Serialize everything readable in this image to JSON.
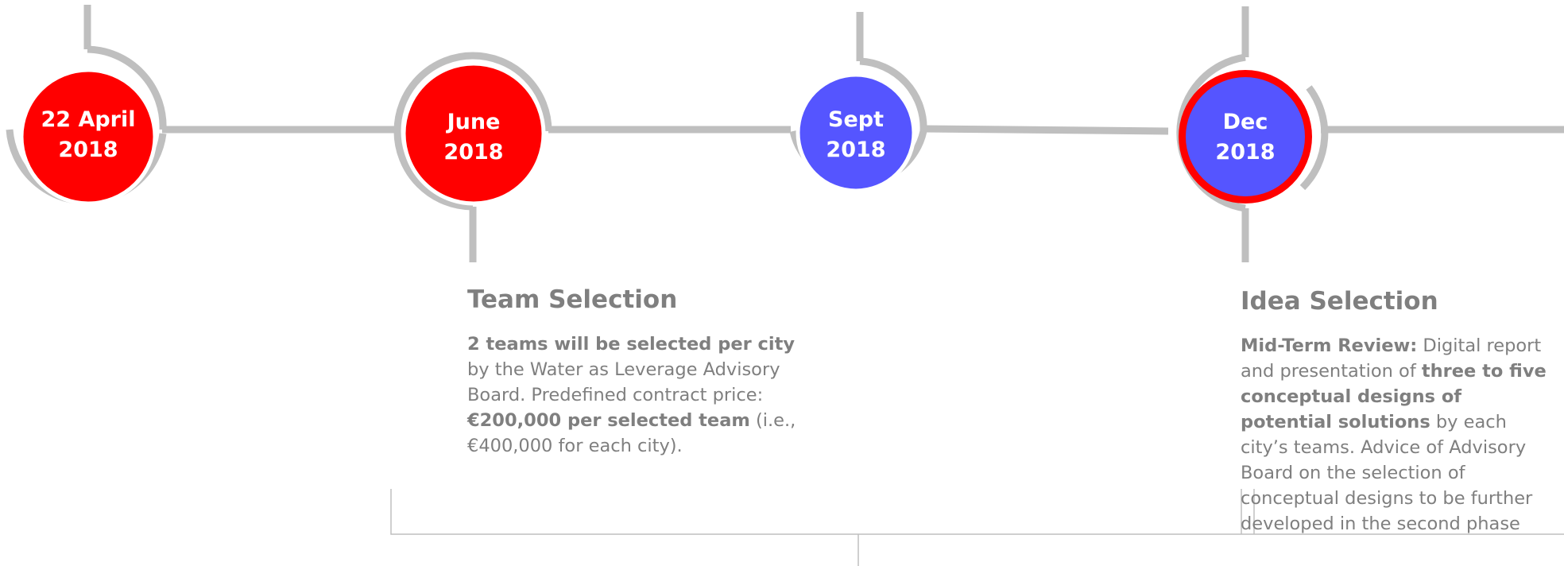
{
  "colors": {
    "connector": "#bfbfbf",
    "completed": "#ff0000",
    "upcoming": "#5555ff",
    "current_ring": "#ff0000",
    "text": "#7f7f7f"
  },
  "milestones": [
    {
      "line1": "22 April",
      "line2": "2018",
      "status": "completed"
    },
    {
      "line1": "June",
      "line2": "2018",
      "status": "completed"
    },
    {
      "line1": "Sept",
      "line2": "2018",
      "status": "upcoming"
    },
    {
      "line1": "Dec",
      "line2": "2018",
      "status": "current"
    }
  ],
  "team_selection": {
    "title": "Team Selection",
    "b1": "2 teams will be selected per city",
    "t1": " by the Water as Leverage Advisory Board. Predefined contract price: ",
    "b2": "€200,000 per selected team",
    "t2": " (i.e., €400,000 for each city)."
  },
  "idea_selection": {
    "title": "Idea Selection",
    "b1": "Mid-Term Review:",
    "t1": " Digital report and presentation of ",
    "b2": "three to five conceptual designs of potential solutions",
    "t2": " by each city’s teams. Advice of Advisory Board on the selection of conceptual designs to be further developed in the second phase"
  }
}
